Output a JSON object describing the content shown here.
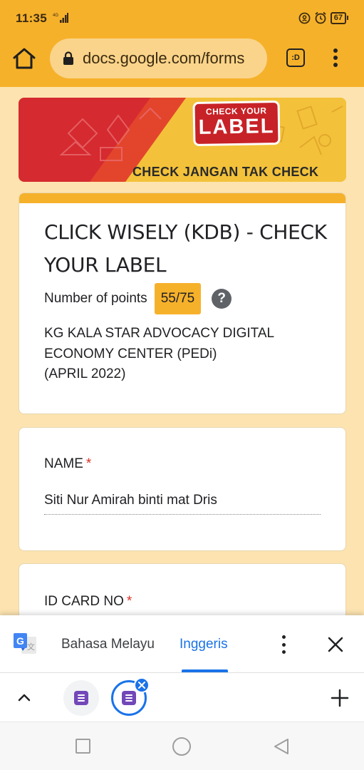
{
  "status_bar": {
    "time": "11:35",
    "network_badge": "4G",
    "battery_level": "67",
    "icons": [
      "signal-icon",
      "vpn-key-icon",
      "alarm-icon",
      "battery-icon"
    ]
  },
  "browser": {
    "url": "docs.google.com/forms",
    "tabs_button_label": ":D",
    "icons": [
      "home-icon",
      "lock-icon",
      "more-vert-icon"
    ]
  },
  "banner": {
    "badge_top": "CHECK YOUR",
    "badge_main": "LABEL",
    "tagline": "CHECK JANGAN TAK CHECK"
  },
  "form": {
    "title": "CLICK WISELY (KDB) - CHECK YOUR LABEL",
    "points_label": "Number of points",
    "points_value": "55/75",
    "help_glyph": "?",
    "description_lines": [
      "KG KALA STAR ADVOCACY DIGITAL",
      "ECONOMY CENTER (PEDi)",
      "(APRIL 2022)"
    ],
    "questions": [
      {
        "label": "NAME",
        "required_mark": "*",
        "answer": "Siti Nur Amirah binti mat Dris"
      },
      {
        "label": "ID CARD NO",
        "required_mark": "*",
        "answer": ""
      }
    ],
    "colors": {
      "accent": "#f6b12b",
      "background": "#fce3b0",
      "required": "#d93025"
    }
  },
  "translate_bar": {
    "source_language": "Bahasa Melayu",
    "target_language": "Inggeris",
    "selected": "Inggeris",
    "icons": [
      "google-translate-icon",
      "more-vert-icon",
      "close-icon"
    ]
  },
  "tab_strip": {
    "icons": [
      "chevron-up-icon",
      "google-forms-icon",
      "close-icon",
      "plus-icon"
    ]
  },
  "nav_bar": {
    "icons": [
      "recents-icon",
      "home-icon",
      "back-icon"
    ]
  }
}
